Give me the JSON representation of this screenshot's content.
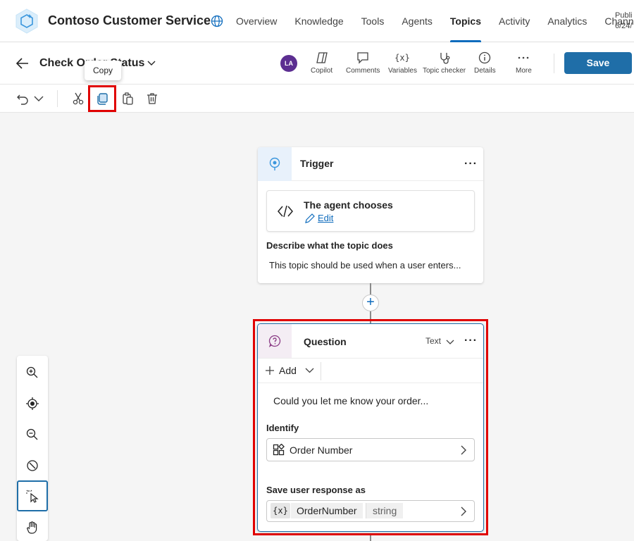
{
  "app": {
    "title": "Contoso Customer Service",
    "logo_icon": "copilot-studio-hexagon-icon",
    "accent_color": "#0f6cbd"
  },
  "nav": {
    "tabs": [
      "Overview",
      "Knowledge",
      "Tools",
      "Agents",
      "Topics",
      "Activity",
      "Analytics",
      "Channe"
    ],
    "active": "Topics",
    "publish_status_line1": "Publi",
    "publish_status_line2": "6/24/"
  },
  "topic": {
    "name": "Check Order Status",
    "avatar_initials": "LA"
  },
  "toolbar": {
    "copilot": "Copilot",
    "comments": "Comments",
    "variables": "Variables",
    "topic_checker": "Topic checker",
    "details": "Details",
    "more": "More",
    "save": "Save",
    "save_color": "#1f6ea8"
  },
  "edit_toolbar": {
    "tooltip": "Copy",
    "items": [
      "undo-icon",
      "chevron-down-icon",
      "cut-icon",
      "copy-icon",
      "paste-icon",
      "delete-icon"
    ],
    "highlight_color": "#e00000"
  },
  "trigger_node": {
    "title": "Trigger",
    "chooser_title": "The agent chooses",
    "edit_link": "Edit",
    "description_label": "Describe what the topic does",
    "description_text": "This topic should be used when a user enters..."
  },
  "question_node": {
    "title": "Question",
    "type": "Text",
    "add_label": "Add",
    "message": "Could you let me know your order...",
    "identify_label": "Identify",
    "identify_value": "Order Number",
    "save_label": "Save user response as",
    "var_chip": "{x}",
    "var_name": "OrderNumber",
    "var_type": "string"
  },
  "zoom_panel": {
    "items": [
      "zoom-in-icon",
      "fit-view-icon",
      "zoom-out-icon",
      "reset-icon",
      "select-mode-icon",
      "pan-hand-icon"
    ],
    "active": "select-mode-icon"
  }
}
